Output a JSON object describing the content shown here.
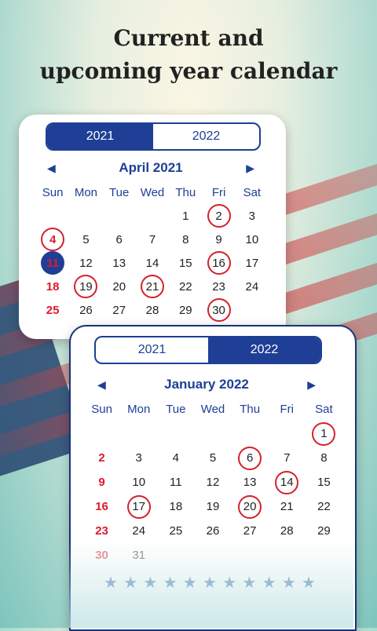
{
  "headline": "Current and\nupcoming year calendar",
  "weekdays": [
    "Sun",
    "Mon",
    "Tue",
    "Wed",
    "Thu",
    "Fri",
    "Sat"
  ],
  "calendar1": {
    "tabs": [
      "2021",
      "2022"
    ],
    "active_tab": 0,
    "month_title": "April 2021",
    "days": [
      {
        "d": ""
      },
      {
        "d": ""
      },
      {
        "d": ""
      },
      {
        "d": ""
      },
      {
        "d": "1"
      },
      {
        "d": "2",
        "c": 1
      },
      {
        "d": "3"
      },
      {
        "d": "4",
        "c": 1
      },
      {
        "d": "5"
      },
      {
        "d": "6"
      },
      {
        "d": "7"
      },
      {
        "d": "8"
      },
      {
        "d": "9"
      },
      {
        "d": "10"
      },
      {
        "d": "11",
        "t": 1
      },
      {
        "d": "12"
      },
      {
        "d": "13"
      },
      {
        "d": "14"
      },
      {
        "d": "15"
      },
      {
        "d": "16",
        "c": 1
      },
      {
        "d": "17"
      },
      {
        "d": "18"
      },
      {
        "d": "19",
        "c": 1
      },
      {
        "d": "20"
      },
      {
        "d": "21",
        "c": 1
      },
      {
        "d": "22"
      },
      {
        "d": "23"
      },
      {
        "d": "24"
      },
      {
        "d": "25"
      },
      {
        "d": "26"
      },
      {
        "d": "27"
      },
      {
        "d": "28"
      },
      {
        "d": "29"
      },
      {
        "d": "30",
        "c": 1
      },
      {
        "d": ""
      }
    ]
  },
  "calendar2": {
    "tabs": [
      "2021",
      "2022"
    ],
    "active_tab": 1,
    "month_title": "January 2022",
    "days": [
      {
        "d": ""
      },
      {
        "d": ""
      },
      {
        "d": ""
      },
      {
        "d": ""
      },
      {
        "d": ""
      },
      {
        "d": ""
      },
      {
        "d": "1",
        "c": 1
      },
      {
        "d": "2"
      },
      {
        "d": "3"
      },
      {
        "d": "4"
      },
      {
        "d": "5"
      },
      {
        "d": "6",
        "c": 1
      },
      {
        "d": "7"
      },
      {
        "d": "8"
      },
      {
        "d": "9"
      },
      {
        "d": "10"
      },
      {
        "d": "11"
      },
      {
        "d": "12"
      },
      {
        "d": "13"
      },
      {
        "d": "14",
        "c": 1
      },
      {
        "d": "15"
      },
      {
        "d": "16"
      },
      {
        "d": "17",
        "c": 1
      },
      {
        "d": "18"
      },
      {
        "d": "19"
      },
      {
        "d": "20",
        "c": 1
      },
      {
        "d": "21"
      },
      {
        "d": "22"
      },
      {
        "d": "23"
      },
      {
        "d": "24"
      },
      {
        "d": "25"
      },
      {
        "d": "26"
      },
      {
        "d": "27"
      },
      {
        "d": "28"
      },
      {
        "d": "29"
      },
      {
        "d": "30",
        "f": 1
      },
      {
        "d": "31",
        "f": 1
      },
      {
        "d": ""
      },
      {
        "d": ""
      },
      {
        "d": ""
      },
      {
        "d": ""
      },
      {
        "d": ""
      }
    ]
  },
  "colors": {
    "brand_blue": "#1e3f95",
    "holiday_red": "#e0182d",
    "circle_red": "#d4212c"
  },
  "icons": {
    "prev": "chevron-left-icon",
    "next": "chevron-right-icon",
    "star": "star-icon"
  }
}
